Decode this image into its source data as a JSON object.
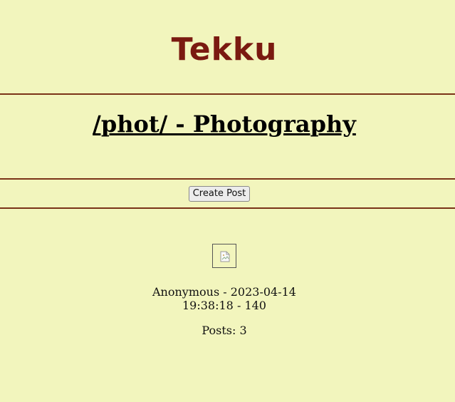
{
  "site": {
    "logo_text": "Tekku"
  },
  "board": {
    "title": "/phot/ - Photography"
  },
  "toolbar": {
    "create_post_label": "Create Post"
  },
  "thread": {
    "thumbnail_icon": "broken-image-icon",
    "author": "Anonymous",
    "meta_text": "Anonymous - 2023-04-14 19:38:18 - 140",
    "posts_text": "Posts: 3"
  },
  "colors": {
    "background": "#f2f5bd",
    "brand": "#7a1a10",
    "rule": "#7a3318"
  }
}
